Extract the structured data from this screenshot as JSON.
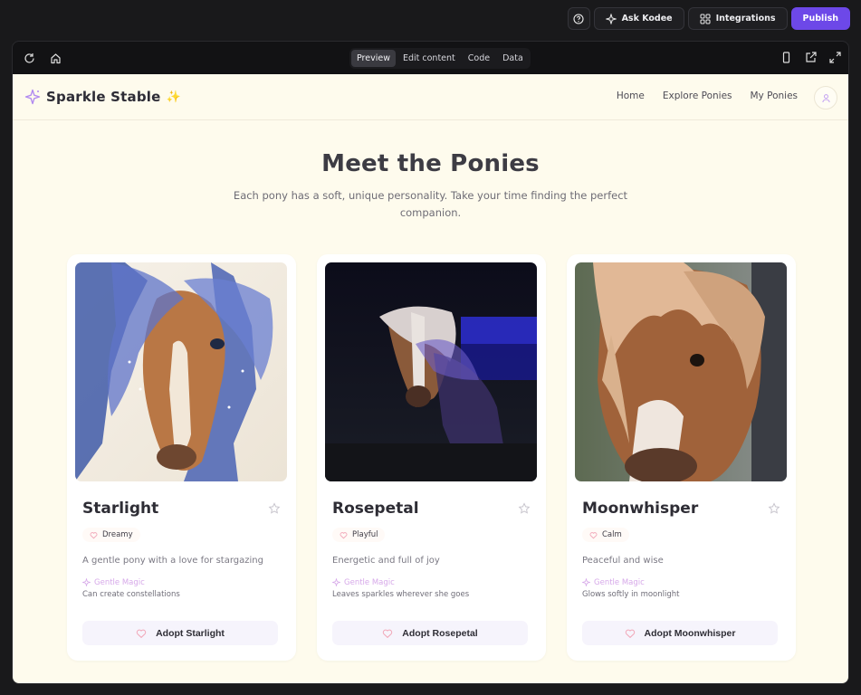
{
  "topbar": {
    "ask_label": "Ask Kodee",
    "integrations_label": "Integrations",
    "publish_label": "Publish"
  },
  "editor": {
    "tabs": [
      "Preview",
      "Edit content",
      "Code",
      "Data"
    ],
    "active_tab": "Preview"
  },
  "site": {
    "brand": "Sparkle Stable",
    "brand_emoji": "✨",
    "nav": [
      "Home",
      "Explore Ponies",
      "My Ponies"
    ],
    "hero_title": "Meet the Ponies",
    "hero_subtitle": "Each pony has a soft, unique personality. Take your time finding the perfect companion.",
    "magic_label": "Gentle Magic",
    "colors": {
      "background": "#fefbed",
      "accent": "#6d48e8",
      "magic": "#d6a8e9"
    },
    "ponies": [
      {
        "name": "Starlight",
        "mood": "Dreamy",
        "description": "A gentle pony with a love for stargazing",
        "ability": "Can create constellations",
        "adopt_label": "Adopt Starlight"
      },
      {
        "name": "Rosepetal",
        "mood": "Playful",
        "description": "Energetic and full of joy",
        "ability": "Leaves sparkles wherever she goes",
        "adopt_label": "Adopt Rosepetal"
      },
      {
        "name": "Moonwhisper",
        "mood": "Calm",
        "description": "Peaceful and wise",
        "ability": "Glows softly in moonlight",
        "adopt_label": "Adopt Moonwhisper"
      }
    ]
  }
}
